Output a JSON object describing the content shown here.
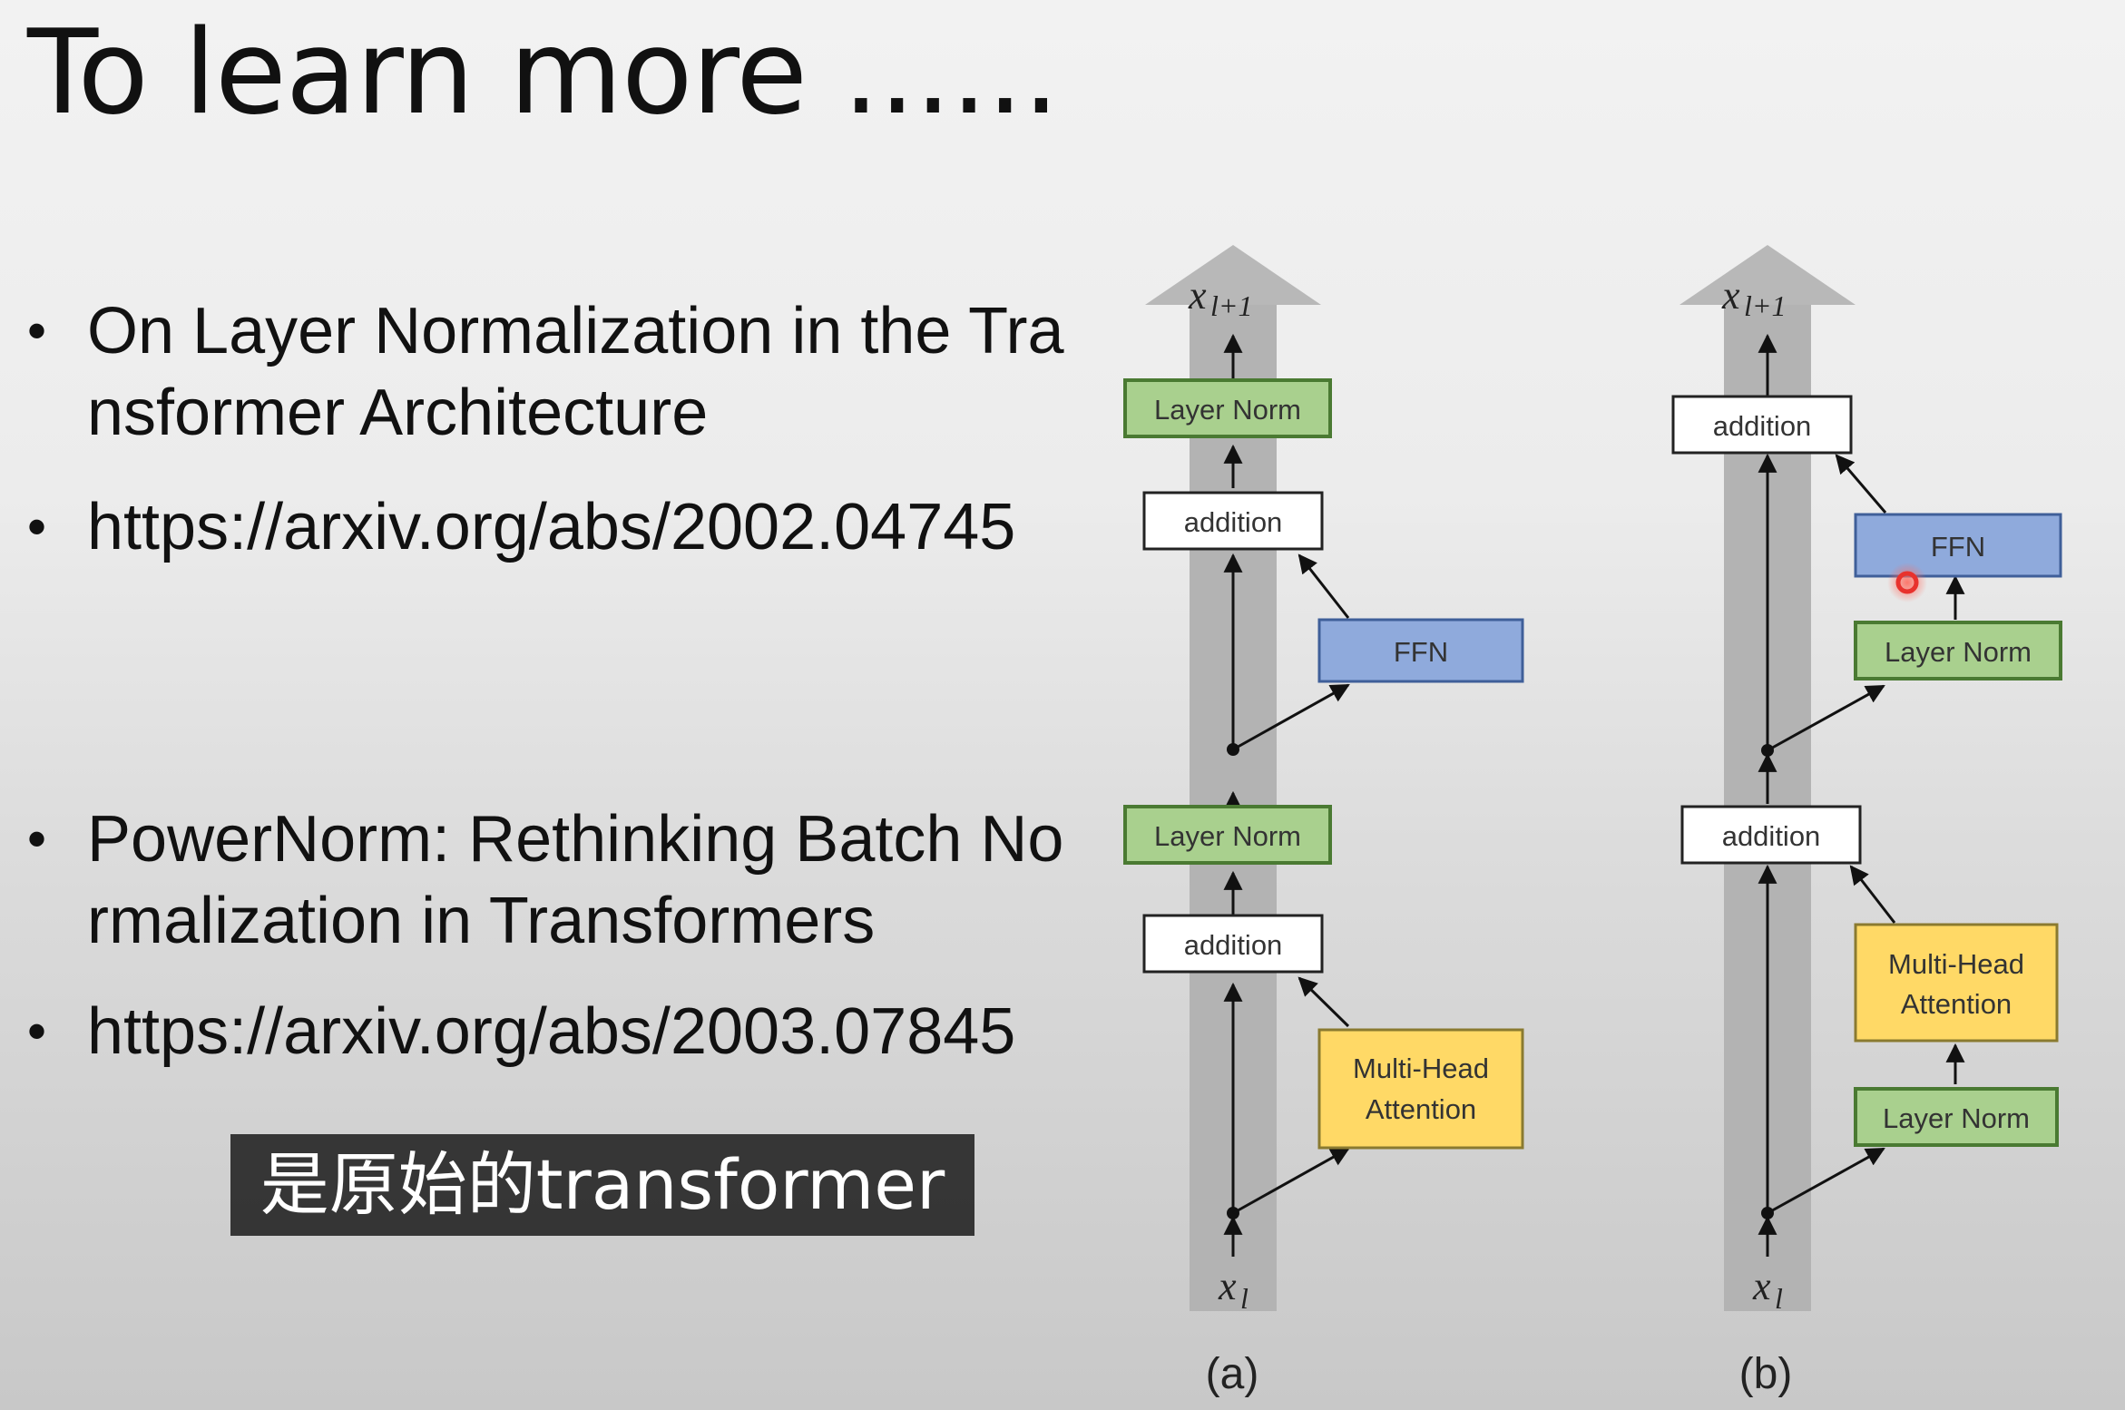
{
  "slide": {
    "title": "To learn more ......",
    "bullets": [
      {
        "text": "On Layer Normalization in the Transformer Architecture"
      },
      {
        "text": "https://arxiv.org/abs/2002.04745"
      },
      {
        "text": "PowerNorm: Rethinking Batch Normalization in Transformers"
      },
      {
        "text": "https://arxiv.org/abs/2003.07845"
      }
    ],
    "bullet_symbol": "•"
  },
  "subtitle": "是原始的transformer",
  "diagram_a": {
    "caption": "(a)",
    "output_label": "x",
    "output_sub": "l+1",
    "input_label": "x",
    "input_sub": "l",
    "blocks": {
      "top_layer_norm": "Layer Norm",
      "top_addition": "addition",
      "ffn": "FFN",
      "mid_layer_norm": "Layer Norm",
      "bottom_addition": "addition",
      "attention_line1": "Multi-Head",
      "attention_line2": "Attention"
    }
  },
  "diagram_b": {
    "caption": "(b)",
    "output_label": "x",
    "output_sub": "l+1",
    "input_label": "x",
    "input_sub": "l",
    "blocks": {
      "top_addition": "addition",
      "ffn": "FFN",
      "ffn_layer_norm": "Layer Norm",
      "mid_addition": "addition",
      "attention_line1": "Multi-Head",
      "attention_line2": "Attention",
      "attn_layer_norm": "Layer Norm"
    }
  },
  "colors": {
    "layer_norm_fill": "#a9d08e",
    "layer_norm_stroke": "#4a7a32",
    "ffn_fill": "#8faadc",
    "ffn_stroke": "#3f5f99",
    "attention_fill": "#ffd966",
    "attention_stroke": "#8a7a30",
    "addition_fill": "#ffffff",
    "residual_column": "#b3b3b3",
    "subtitle_bg": "#282828",
    "pointer": "#e8322d"
  }
}
